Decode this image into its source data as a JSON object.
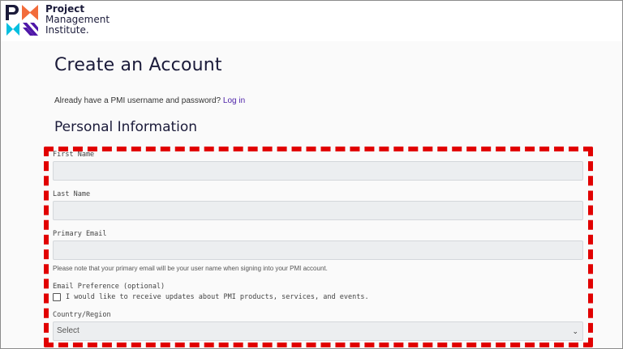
{
  "header": {
    "logo_line1": "Project",
    "logo_line2": "Management",
    "logo_line3": "Institute."
  },
  "page": {
    "title": "Create an Account",
    "login_prompt": "Already have a PMI username and password?",
    "login_link": "Log in",
    "section_title": "Personal Information"
  },
  "form": {
    "first_name_label": "First Name",
    "first_name_value": "",
    "last_name_label": "Last Name",
    "last_name_value": "",
    "email_label": "Primary Email",
    "email_value": "",
    "email_note": "Please note that your primary email will be your user name when signing into your PMI account.",
    "email_pref_label": "Email Preference (optional)",
    "email_pref_checkbox_label": "I would like to receive updates about PMI products, services, and events.",
    "email_pref_checked": false,
    "country_label": "Country/Region",
    "country_value": "Select"
  },
  "colors": {
    "highlight": "#e10000",
    "link": "#4b1fa8",
    "logo_orange": "#f26b3a",
    "logo_teal": "#05bfe0",
    "logo_purple": "#4f17a8",
    "logo_dark": "#1b1b3a"
  }
}
